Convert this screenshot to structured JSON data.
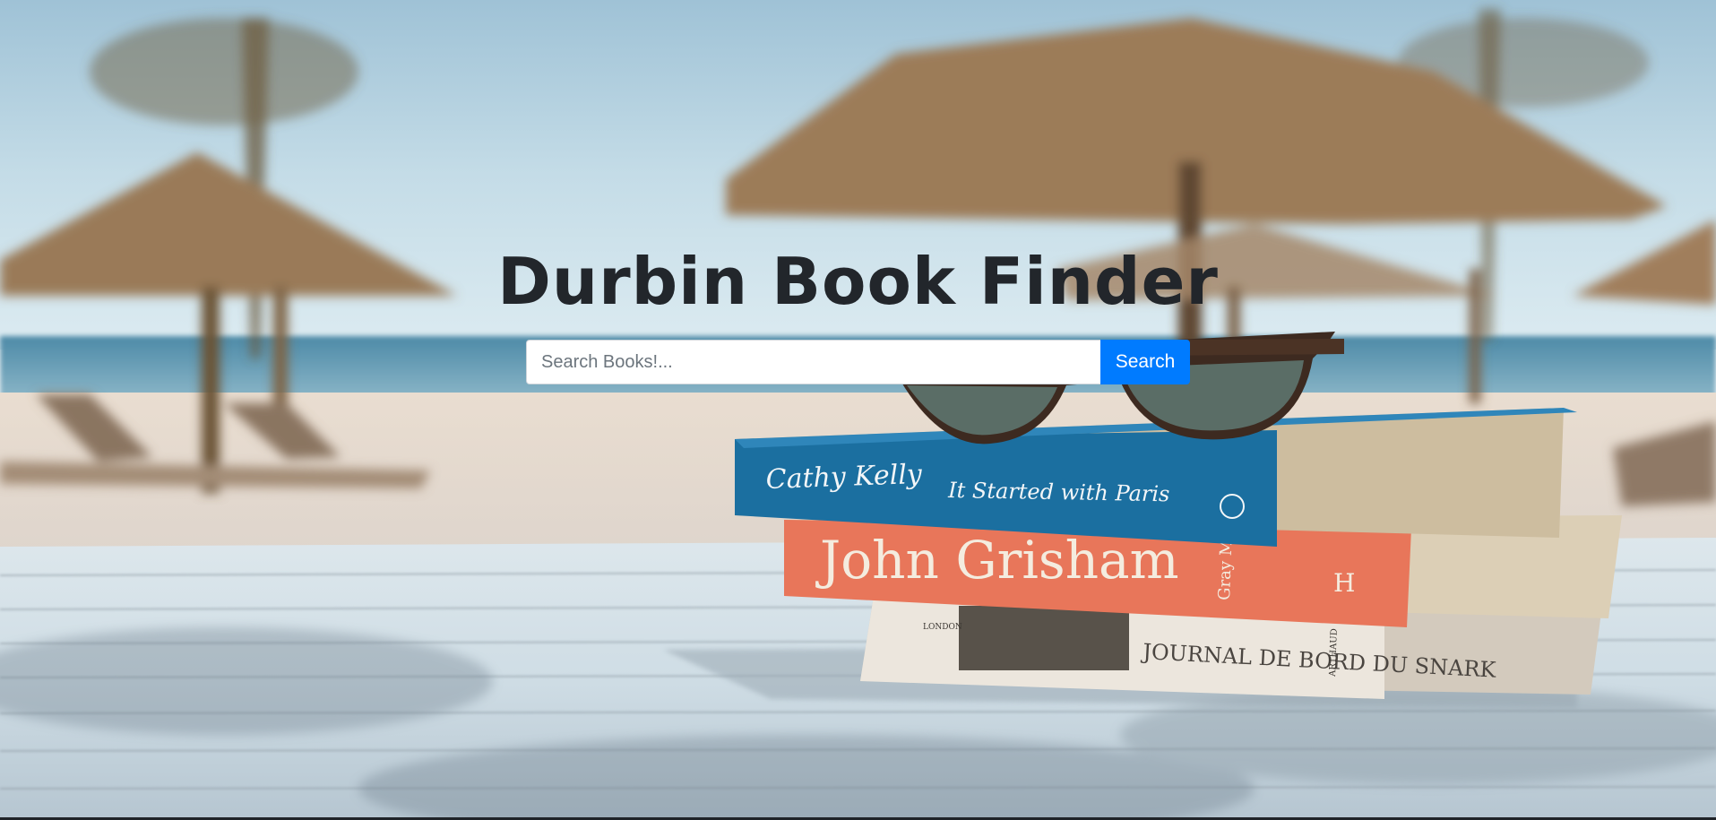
{
  "page": {
    "title": "Durbin Book Finder"
  },
  "search": {
    "placeholder": "Search Books!...",
    "value": "",
    "button_label": "Search"
  },
  "hero_image": {
    "book_spines": [
      {
        "author": "Cathy Kelly",
        "title": "It Started with Paris"
      },
      {
        "author": "John Grisham",
        "title": "Gray Mountain",
        "publisher": "H"
      },
      {
        "title": "JOURNAL DE BORD DU SNARK",
        "author": "ARTHAUD",
        "series": "LONDON"
      }
    ]
  },
  "colors": {
    "accent": "#007bff",
    "title": "#22262b",
    "book_blue": "#1b6fa0",
    "book_orange": "#e8765a",
    "book_cream": "#ece6dd"
  }
}
